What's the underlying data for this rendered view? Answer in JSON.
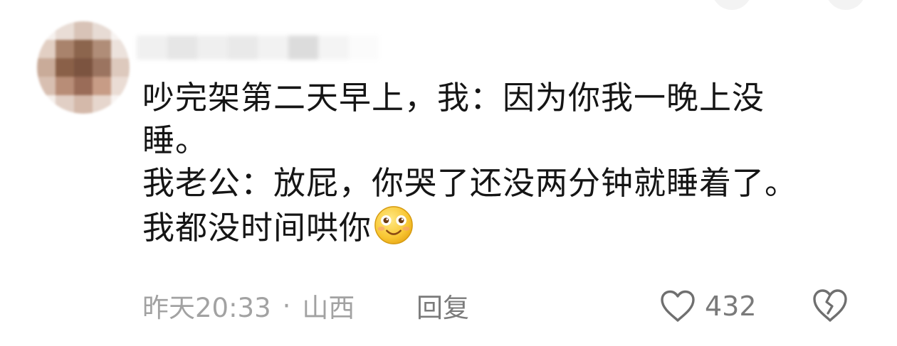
{
  "comment": {
    "lines": [
      "吵完架第二天早上，我：因为你我一晚上没",
      "睡。",
      "我老公：放屁，你哭了还没两分钟就睡着了。",
      "我都没时间哄你"
    ],
    "emoji": "smiling-face-emoji"
  },
  "meta": {
    "time": "昨天20:33",
    "separator": "·",
    "location": "山西",
    "reply_label": "回复",
    "like_count": "432"
  },
  "icons": {
    "like": "heart-outline-icon",
    "dislike": "broken-heart-icon"
  },
  "colors": {
    "text": "#151515",
    "meta": "#a2a2a2",
    "icon": "#6f6f6f"
  }
}
